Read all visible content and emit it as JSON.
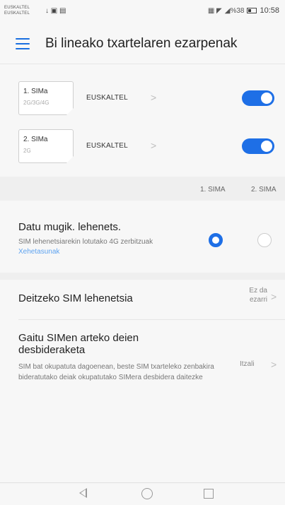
{
  "status_bar": {
    "carrier_1": "EUSKALTEL",
    "carrier_2": "EUSKALTEL",
    "left_icons": "↓ ▣ ▤",
    "right_icons": "▦ ◤",
    "signal_text": "◢%38",
    "time": "10:58"
  },
  "header": {
    "title": "Bi lineako txartelaren ezarpenak",
    "menu_icon": "hamburger-icon"
  },
  "sim_cards": [
    {
      "name": "1. SIMa",
      "tech": "2G/3G/4G",
      "operator": "EUSKALTEL",
      "enabled": true
    },
    {
      "name": "2. SIMa",
      "tech": "2G",
      "operator": "EUSKALTEL",
      "enabled": true
    }
  ],
  "sim_columns": {
    "sim1": "1. SIMA",
    "sim2": "2. SIMA"
  },
  "mobile_data": {
    "title": "Datu mugik. lehenets.",
    "desc": "SIM lehenetsiarekin lotutako 4G zerbitzuak",
    "link": "Xehetasunak",
    "selected": "sim1"
  },
  "default_call": {
    "title": "Deitzeko SIM lehenetsia",
    "value": "Ez da ezarri"
  },
  "call_forwarding": {
    "title": "Gaitu SIMen arteko deien desbideraketa",
    "desc": "SIM bat okupatuta dagoenean, beste SIM txarteleko zenbakira bideratutako deiak okupatutako SIMera desbidera daitezke",
    "value": "Itzali"
  },
  "colors": {
    "accent": "#1e6fe6",
    "link": "#5ea3f0",
    "background": "#f7f7f7"
  }
}
